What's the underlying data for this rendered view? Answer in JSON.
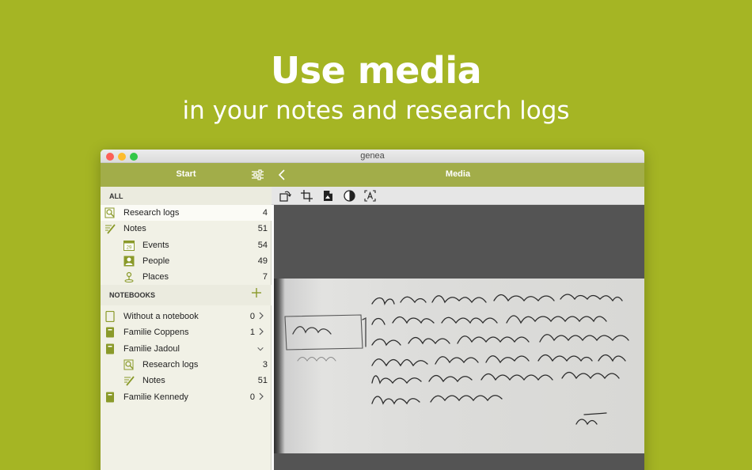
{
  "hero": {
    "title": "Use media",
    "subtitle": "in your notes and research logs"
  },
  "window": {
    "title": "genea"
  },
  "sidebar": {
    "header_title": "Start",
    "all_label": "ALL",
    "all_items": [
      {
        "label": "Research logs",
        "count": "4",
        "icon": "magnifier-document-icon"
      },
      {
        "label": "Notes",
        "count": "51",
        "icon": "pencil-note-icon"
      },
      {
        "label": "Events",
        "count": "54",
        "icon": "calendar-icon"
      },
      {
        "label": "People",
        "count": "49",
        "icon": "person-icon"
      },
      {
        "label": "Places",
        "count": "7",
        "icon": "map-pin-icon"
      }
    ],
    "notebooks_label": "NOTEBOOKS",
    "notebooks": [
      {
        "label": "Without a notebook",
        "count": "0",
        "icon": "notebook-outline-icon",
        "expanded": false
      },
      {
        "label": "Familie Coppens",
        "count": "1",
        "icon": "notebook-icon",
        "expanded": false
      },
      {
        "label": "Familie Jadoul",
        "count": "",
        "icon": "notebook-icon",
        "expanded": true
      },
      {
        "label": "Research logs",
        "count": "3",
        "icon": "magnifier-document-icon"
      },
      {
        "label": "Notes",
        "count": "51",
        "icon": "pencil-note-icon"
      },
      {
        "label": "Familie Kennedy",
        "count": "0",
        "icon": "notebook-icon",
        "expanded": false
      }
    ]
  },
  "main": {
    "title": "Media",
    "toolbar": [
      "rotate-icon",
      "crop-icon",
      "document-icon",
      "contrast-icon",
      "text-recognition-icon"
    ]
  },
  "colors": {
    "background": "#a5b524",
    "header": "#a2ad49",
    "accent_green": "#8a9a2a"
  }
}
